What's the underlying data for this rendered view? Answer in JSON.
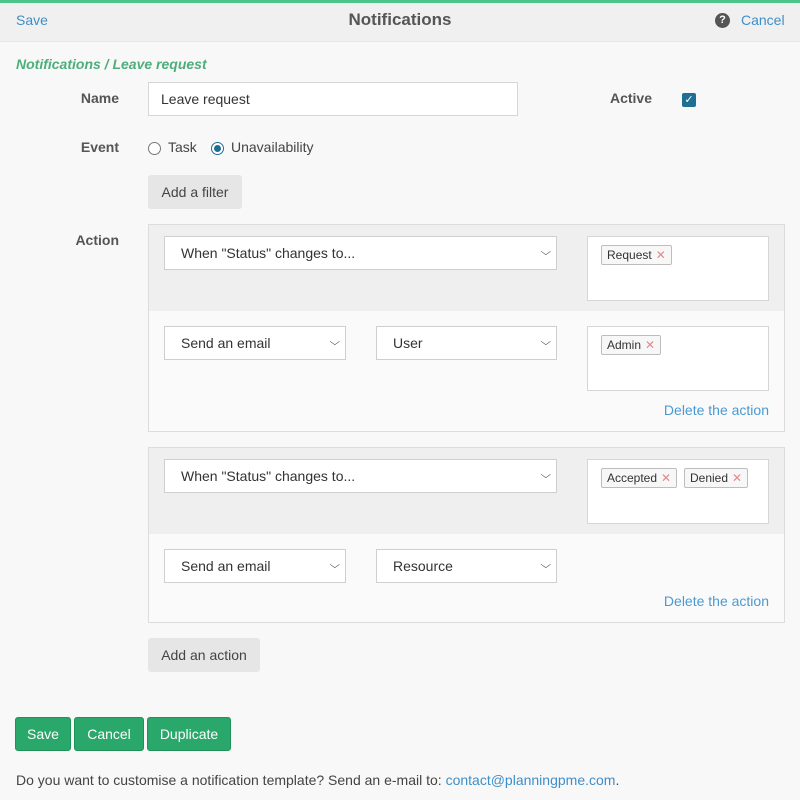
{
  "header": {
    "save": "Save",
    "title": "Notifications",
    "help_icon": "?",
    "cancel": "Cancel"
  },
  "breadcrumb": "Notifications / Leave request",
  "form": {
    "name_label": "Name",
    "name_value": "Leave request",
    "active_label": "Active",
    "active_checked": true,
    "event_label": "Event",
    "event_options": [
      "Task",
      "Unavailability"
    ],
    "event_selected": "Unavailability",
    "add_filter": "Add a filter",
    "action_label": "Action"
  },
  "actions": [
    {
      "condition": "When \"Status\" changes to...",
      "condition_tags": [
        "Request"
      ],
      "send": "Send an email",
      "recipient": "User",
      "recipient_tags": [
        "Admin"
      ],
      "delete": "Delete the action"
    },
    {
      "condition": "When \"Status\" changes to...",
      "condition_tags": [
        "Accepted",
        "Denied"
      ],
      "send": "Send an email",
      "recipient": "Resource",
      "delete": "Delete the action"
    }
  ],
  "add_action": "Add an action",
  "buttons": {
    "save": "Save",
    "cancel": "Cancel",
    "duplicate": "Duplicate"
  },
  "footer": {
    "text": "Do you want to customise a notification template? Send an e-mail to: ",
    "email": "contact@planningpme.com",
    "end": "."
  },
  "colors": {
    "accent_green": "#2aa76a",
    "link_blue": "#3f8fc7",
    "breadcrumb_green": "#4caf7a"
  }
}
